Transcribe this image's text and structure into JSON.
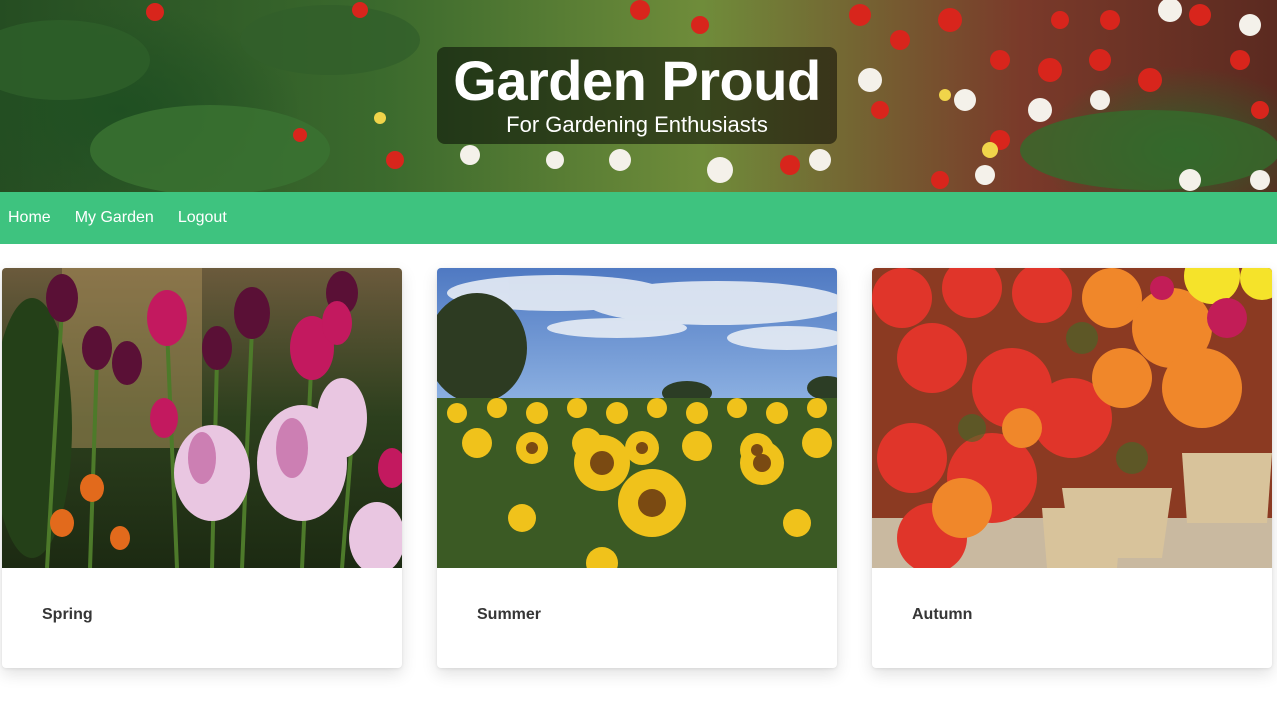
{
  "hero": {
    "title": "Garden Proud",
    "subtitle": "For Gardening Enthusiasts"
  },
  "nav": {
    "items": [
      {
        "label": "Home"
      },
      {
        "label": "My Garden"
      },
      {
        "label": "Logout"
      }
    ]
  },
  "cards": [
    {
      "title": "Spring",
      "image": "tulips-photo"
    },
    {
      "title": "Summer",
      "image": "sunflower-field-photo"
    },
    {
      "title": "Autumn",
      "image": "chrysanthemum-pots-photo"
    }
  ],
  "colors": {
    "nav_bg": "#3ec37f",
    "card_title": "#363636",
    "hero_overlay": "rgba(0,0,0,0.5)"
  }
}
